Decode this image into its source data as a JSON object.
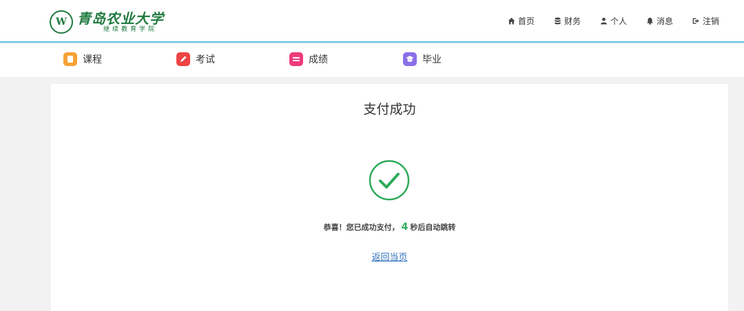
{
  "brand": {
    "seal_letter": "W",
    "name": "青岛农业大学",
    "subtitle": "继续教育学院"
  },
  "top_nav": [
    {
      "label": "首页",
      "icon": "home-icon"
    },
    {
      "label": "财务",
      "icon": "database-icon"
    },
    {
      "label": "个人",
      "icon": "user-icon"
    },
    {
      "label": "消息",
      "icon": "bell-icon"
    },
    {
      "label": "注销",
      "icon": "sign-out-icon"
    }
  ],
  "sub_nav": [
    {
      "label": "课程",
      "icon": "course-icon",
      "color": "#f7a136"
    },
    {
      "label": "考试",
      "icon": "exam-icon",
      "color": "#ee4444"
    },
    {
      "label": "成绩",
      "icon": "score-icon",
      "color": "#ee3a7a"
    },
    {
      "label": "毕业",
      "icon": "graduate-icon",
      "color": "#8a6fe8"
    }
  ],
  "result": {
    "title": "支付成功",
    "msg_prefix": "恭喜！您已成功支付，",
    "countdown": "4",
    "msg_suffix": "秒后自动跳转",
    "back_link": "返回当页"
  },
  "colors": {
    "accent_line": "#5bc0de",
    "success": "#2eaa5a",
    "brand_green": "#1f7a3f",
    "link": "#2a6ebb"
  }
}
